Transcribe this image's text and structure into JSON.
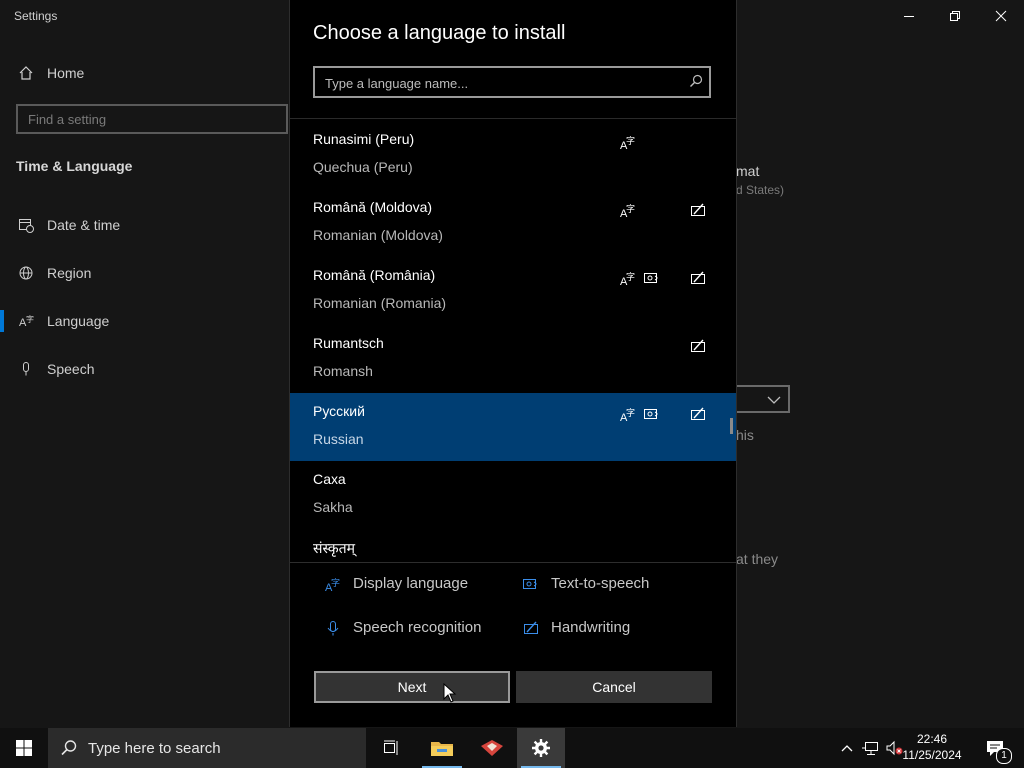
{
  "settings": {
    "window_title": "Settings",
    "home_label": "Home",
    "find_placeholder": "Find a setting",
    "section_title": "Time & Language",
    "nav": [
      {
        "label": "Date & time",
        "icon": "calendar-clock-icon"
      },
      {
        "label": "Region",
        "icon": "globe-icon"
      },
      {
        "label": "Language",
        "icon": "language-icon",
        "selected": true
      },
      {
        "label": "Speech",
        "icon": "microphone-icon"
      }
    ],
    "peek_text": {
      "format": "mat",
      "region": "d States)",
      "this": "his",
      "that_they": "at they"
    }
  },
  "dialog": {
    "title": "Choose a language to install",
    "search_placeholder": "Type a language name...",
    "languages": [
      {
        "native": "Runasimi (Peru)",
        "english": "Quechua (Peru)",
        "display": true,
        "tts": false,
        "handwriting": false
      },
      {
        "native": "Română (Moldova)",
        "english": "Romanian (Moldova)",
        "display": true,
        "tts": false,
        "handwriting": true
      },
      {
        "native": "Română (România)",
        "english": "Romanian (Romania)",
        "display": true,
        "tts": true,
        "handwriting": true
      },
      {
        "native": "Rumantsch",
        "english": "Romansh",
        "display": false,
        "tts": false,
        "handwriting": true
      },
      {
        "native": "Русский",
        "english": "Russian",
        "display": true,
        "tts": true,
        "handwriting": true,
        "selected": true
      },
      {
        "native": "Саха",
        "english": "Sakha",
        "display": false,
        "tts": false,
        "handwriting": false
      },
      {
        "native": "संस्कृतम्",
        "english": "",
        "display": false,
        "tts": false,
        "handwriting": false
      }
    ],
    "legend": {
      "display_language": "Display language",
      "text_to_speech": "Text-to-speech",
      "speech_recognition": "Speech recognition",
      "handwriting": "Handwriting"
    },
    "next_label": "Next",
    "cancel_label": "Cancel"
  },
  "taskbar": {
    "search_placeholder": "Type here to search",
    "time": "22:46",
    "date": "11/25/2024",
    "notification_count": "1"
  },
  "colors": {
    "accent": "#0078d7",
    "selected_row": "#003e73",
    "icon_blue": "#3b8eea"
  }
}
